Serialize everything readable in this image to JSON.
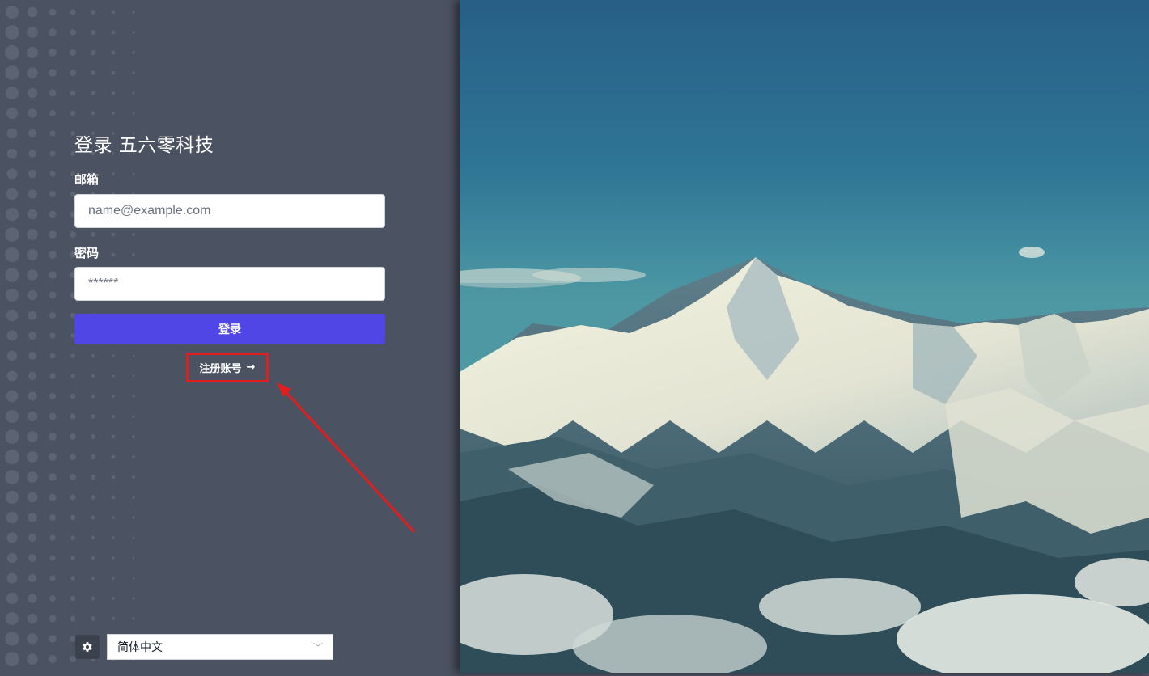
{
  "login": {
    "title": "登录 五六零科技",
    "email_label": "邮箱",
    "email_placeholder": "name@example.com",
    "password_label": "密码",
    "password_placeholder": "******",
    "submit_label": "登录",
    "register_label": "注册账号",
    "register_arrow": "→"
  },
  "footer": {
    "language": "简体中文"
  },
  "colors": {
    "panel_bg": "#4b5261",
    "primary_button": "#4f46e5",
    "highlight": "#e11d1d"
  },
  "icons": [
    "dots-pattern",
    "gear-icon",
    "chevron-down-icon",
    "arrow-right-icon",
    "annotation-arrow",
    "mountain-image"
  ]
}
